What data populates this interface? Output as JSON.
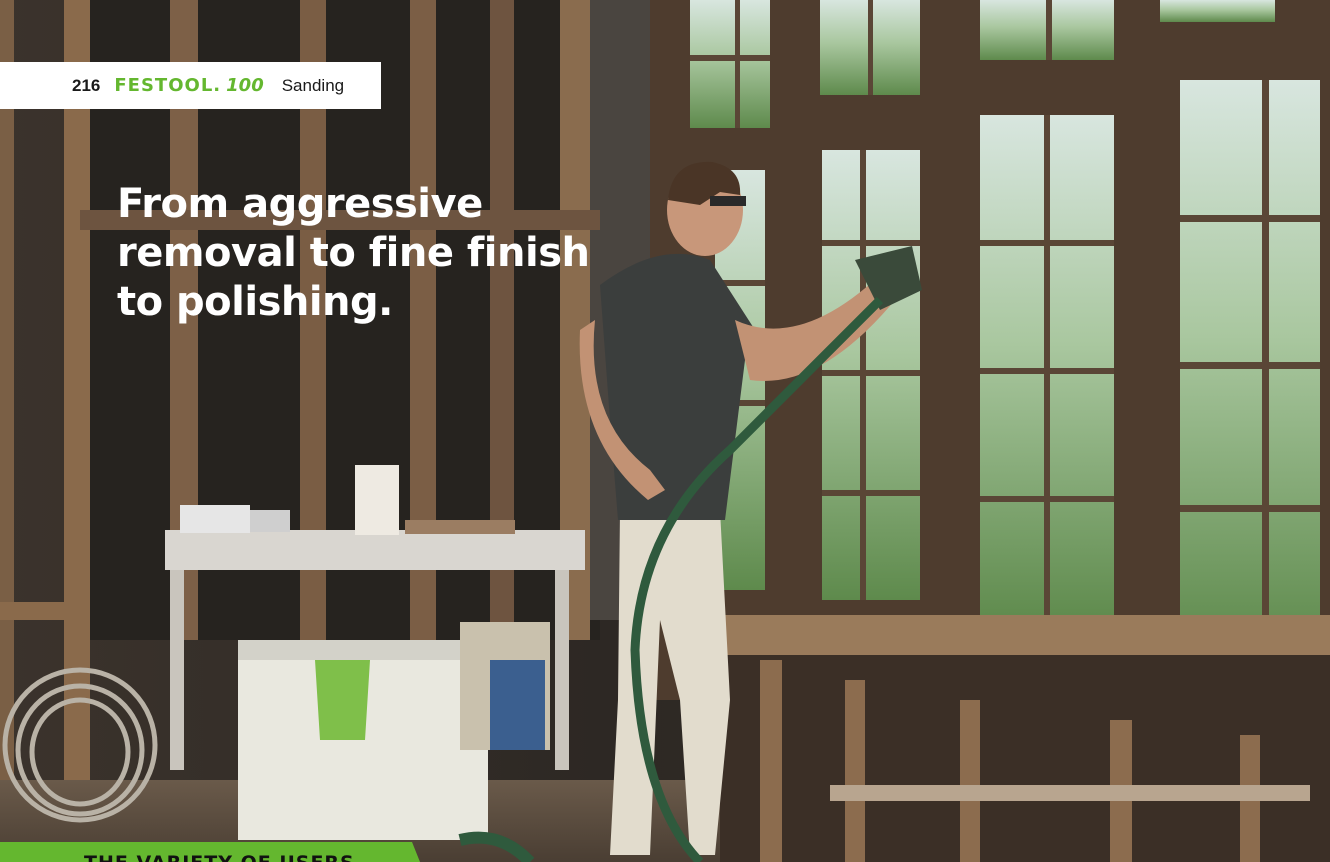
{
  "header": {
    "page_number": "216",
    "brand": "FESTOOL",
    "brand_suffix": "100",
    "section": "Sanding"
  },
  "headline": "From aggressive\nremoval to fine finish\nto polishing.",
  "bottom_tab": {
    "label": "THE VARIETY OF USERS"
  },
  "colors": {
    "brand_green": "#64b72f",
    "headline": "#ffffff",
    "tab_background": "#ffffff"
  }
}
